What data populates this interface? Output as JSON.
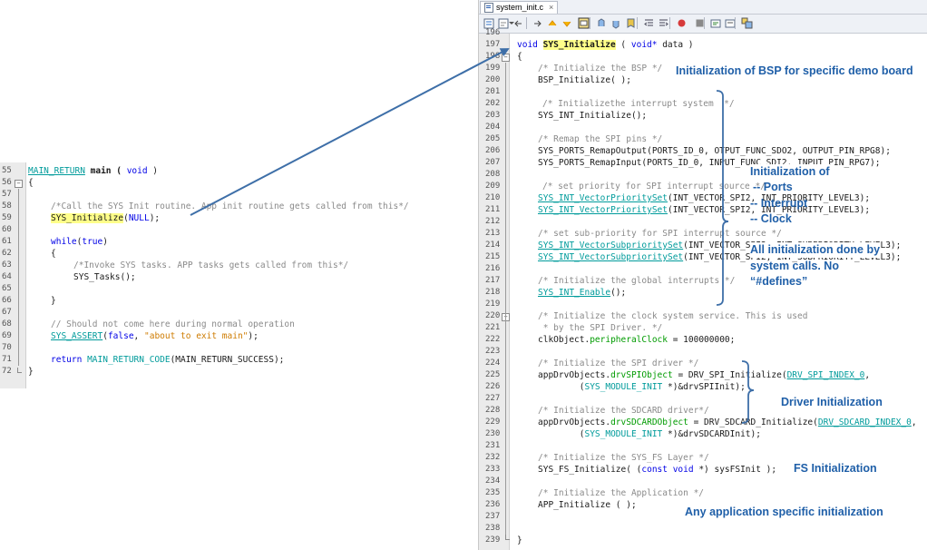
{
  "left_editor": {
    "line_numbers": [
      "55",
      "56",
      "57",
      "58",
      "59",
      "60",
      "61",
      "62",
      "63",
      "64",
      "65",
      "66",
      "67",
      "68",
      "69",
      "70",
      "71",
      "72"
    ],
    "l55_a": "MAIN_RETURN",
    "l55_b": " main ( ",
    "l55_c": "void",
    "l55_d": " )",
    "l56": "{",
    "l58": "/*Call the SYS Init routine. App init routine gets called from this*/",
    "l59_a": "SYS_Initialize",
    "l59_b": "(",
    "l59_c": "NULL",
    "l59_d": ");",
    "l61_a": "while",
    "l61_b": "(",
    "l61_c": "true",
    "l61_d": ")",
    "l62": "{",
    "l63": "/*Invoke SYS tasks. APP tasks gets called from this*/",
    "l64": "SYS_Tasks();",
    "l66": "}",
    "l68": "// Should not come here during normal operation",
    "l69_a": "SYS_ASSERT",
    "l69_b": "(",
    "l69_c": "false",
    "l69_d": ", ",
    "l69_e": "\"about to exit main\"",
    "l69_f": ");",
    "l71_a": "return",
    "l71_b": " ",
    "l71_c": "MAIN_RETURN_CODE",
    "l71_d": "(MAIN_RETURN_SUCCESS);",
    "l72": "}"
  },
  "right_editor": {
    "tab_title": "system_init.c",
    "tab_close": "×",
    "line_numbers": [
      "196",
      "197",
      "198",
      "199",
      "200",
      "201",
      "202",
      "203",
      "204",
      "205",
      "206",
      "207",
      "208",
      "209",
      "210",
      "211",
      "212",
      "213",
      "214",
      "215",
      "216",
      "217",
      "218",
      "219",
      "220",
      "221",
      "222",
      "223",
      "224",
      "225",
      "226",
      "227",
      "228",
      "229",
      "230",
      "231",
      "232",
      "233",
      "234",
      "235",
      "236",
      "237",
      "238",
      "239"
    ],
    "r197_a": "void",
    "r197_b": "SYS_Initialize",
    "r197_c": " ( ",
    "r197_d": "void*",
    "r197_e": " data )",
    "r198": "{",
    "r199": "/* Initialize the BSP */",
    "r200": "BSP_Initialize( );",
    "r202": "/* Initializethe interrupt system  */",
    "r203": "SYS_INT_Initialize();",
    "r205": "/* Remap the SPI pins */",
    "r206": "SYS_PORTS_RemapOutput(PORTS_ID_0, OTPUT_FUNC_SDO2, OUTPUT_PIN_RPG8);",
    "r207": "SYS_PORTS_RemapInput(PORTS_ID_0, INPUT_FUNC_SDI2, INPUT_PIN_RPG7);",
    "r209": "/* set priority for SPI interrupt source */",
    "r210_a": "SYS_INT_VectorPrioritySet",
    "r210_b": "(INT_VECTOR_SPI2, INT_PRIORITY_LEVEL3);",
    "r211_a": "SYS_INT_VectorPrioritySet",
    "r211_b": "(INT_VECTOR_SPI2, INT_PRIORITY_LEVEL3);",
    "r213": "/* set sub-priority for SPI interrupt source */",
    "r214_a": "SYS_INT_VectorSubprioritySet",
    "r214_b": "(INT_VECTOR_SPI2, INT_SUBPRIORITY_LEVEL3);",
    "r215_a": "SYS_INT_VectorSubprioritySet",
    "r215_b": "(INT_VECTOR_SPI2, INT_SUBPRIORITY_LEVEL3);",
    "r217": "/* Initialize the global interrupts */",
    "r218_a": "SYS_INT_Enable",
    "r218_b": "();",
    "r220": "/* Initialize the clock system service. This is used",
    "r221": " * by the SPI Driver. */",
    "r222_a": "clkObject.",
    "r222_b": "peripheralClock",
    "r222_c": " = 100000000;",
    "r224": "/* Initialize the SPI driver */",
    "r225_a": "appDrvObjects.",
    "r225_b": "drvSPIObject",
    "r225_c": " = DRV_SPI_Initialize(",
    "r225_d": "DRV_SPI_INDEX_0",
    "r225_e": ",",
    "r226_a": "        (",
    "r226_b": "SYS_MODULE_INIT",
    "r226_c": " *)&drvSPIInit);",
    "r228": "/* Initialize the SDCARD driver*/",
    "r229_a": "appDrvObjects.",
    "r229_b": "drvSDCARDObject",
    "r229_c": " = DRV_SDCARD_Initialize(",
    "r229_d": "DRV_SDCARD_INDEX_0",
    "r229_e": ",",
    "r230_a": "        (",
    "r230_b": "SYS_MODULE_INIT",
    "r230_c": " *)&drvSDCARDInit);",
    "r232": "/* Initialize the SYS_FS Layer */",
    "r233_a": "SYS_FS_Initialize( (",
    "r233_b": "const void",
    "r233_c": " *) sysFSInit );",
    "r235": "/* Initialize the Application */",
    "r236": "APP_Initialize ( );",
    "r239": "}"
  },
  "annotations": {
    "bsp": "Initialization of BSP for specific demo board",
    "init_of": "Initialization of",
    "ports": "-- Ports",
    "interrupt": "-- Interrupt",
    "clock": "-- Clock",
    "syscalls_1": "All initialization done by",
    "syscalls_2": "system calls. No",
    "syscalls_3": "“#defines”",
    "driver": "Driver Initialization",
    "fs": "FS Initialization",
    "app": "Any application specific initialization"
  },
  "colors": {
    "annotation": "#1f5fa8",
    "arrow": "#3e6fa8",
    "keyword": "#0000e6",
    "comment": "#8a8a8a",
    "string": "#ce7b00",
    "macro": "#009b9b",
    "field": "#009b00",
    "highlight": "#ffff8a"
  },
  "icons": [
    "toggle-source-icon",
    "history-icon",
    "back-icon",
    "forward-icon",
    "find-prev-icon",
    "find-next-icon",
    "toggle-highlight-icon",
    "prev-bookmark-icon",
    "next-bookmark-icon",
    "toggle-bookmark-icon",
    "shift-left-icon",
    "shift-right-icon",
    "record-macro-icon",
    "stop-macro-icon",
    "comment-icon",
    "uncomment-icon",
    "diff-icon"
  ]
}
